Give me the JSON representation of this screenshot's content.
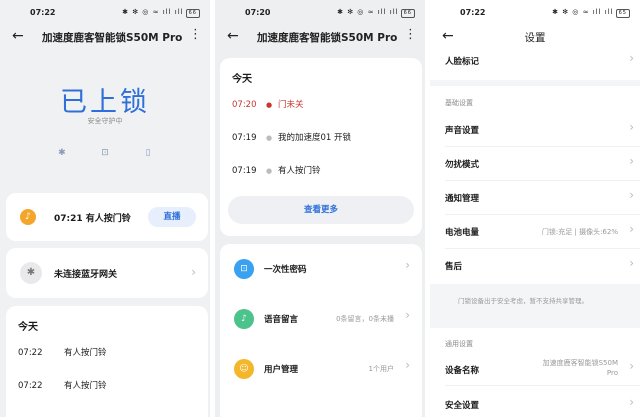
{
  "panel1": {
    "status": {
      "time": "07:22",
      "icons": "✱ ✻ ◎ ≈ ıll ıll",
      "battery": "66"
    },
    "title": "加速度鹿客智能锁S50M Pro",
    "lock_state": "已上锁",
    "guard_text": "安全守护中",
    "device_icons": [
      "bluetooth-icon",
      "lock-icon",
      "doorbell-icon"
    ],
    "bell_card": {
      "time_text": "07:21 有人按门铃",
      "live_label": "直播"
    },
    "bt_card": {
      "text": "未连接蓝牙网关"
    },
    "today": {
      "heading": "今天",
      "rows": [
        {
          "time": "07:22",
          "text": "有人按门铃"
        },
        {
          "time": "07:22",
          "text": "有人按门铃"
        }
      ]
    }
  },
  "panel2": {
    "status": {
      "time": "07:20",
      "icons": "✱ ✻ ◎ ≈ ıll ıll",
      "battery": "66"
    },
    "title": "加速度鹿客智能锁S50M Pro",
    "today": {
      "heading": "今天",
      "rows": [
        {
          "time": "07:20",
          "text": "门未关"
        },
        {
          "time": "07:19",
          "text": "我的加速度01 开锁"
        },
        {
          "time": "07:19",
          "text": "有人按门铃"
        }
      ],
      "see_more": "查看更多"
    },
    "menu": [
      {
        "label": "一次性密码",
        "value": "",
        "icon": "lock-icon",
        "color": "#3aa0f0"
      },
      {
        "label": "语音留言",
        "value": "0条留言，0条未播",
        "icon": "mic-icon",
        "color": "#4cc38a"
      },
      {
        "label": "用户管理",
        "value": "1个用户",
        "icon": "smile-icon",
        "color": "#f4b62a"
      }
    ]
  },
  "panel3": {
    "status": {
      "time": "07:22",
      "icons": "✱ ✻ ◎ ≈ ıll ıll",
      "battery": "65"
    },
    "title": "设置",
    "face_label": "人脸标记",
    "basic_section": "基础设置",
    "items": [
      {
        "label": "声音设置",
        "value": ""
      },
      {
        "label": "勿扰模式",
        "value": ""
      },
      {
        "label": "通知管理",
        "value": ""
      },
      {
        "label": "电池电量",
        "value": "门锁:充足 | 摄像头:62%"
      },
      {
        "label": "售后",
        "value": ""
      }
    ],
    "note": "门锁设备出于安全考虑，暂不支持共享管理。",
    "general_section": "通用设置",
    "device_name_label": "设备名称",
    "device_name_value": "加速度鹿客智能锁S50M Pro",
    "security_label": "安全设置"
  }
}
